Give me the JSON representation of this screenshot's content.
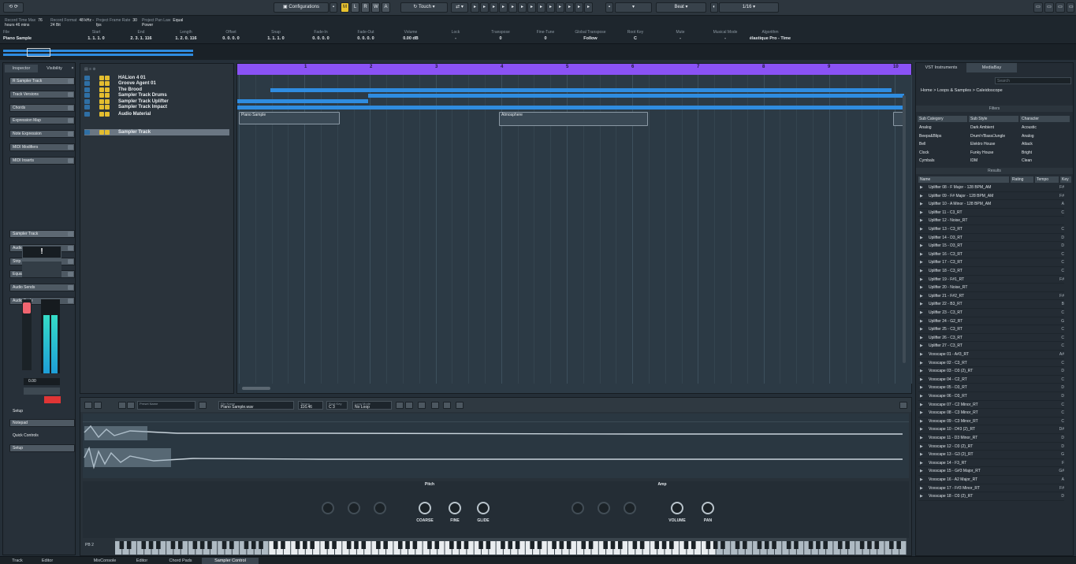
{
  "toolbar": {
    "configurations_label": "Configurations",
    "mode_buttons": [
      "M",
      "L",
      "R",
      "W",
      "A"
    ],
    "touch_label": "Touch",
    "grid_label": "Beat",
    "quantize_label": "1/16",
    "constrain_label": "",
    "transport_values": [
      {
        "label": "Record Time Max",
        "value": "76 hours 46 mins"
      },
      {
        "label": "Record Format",
        "value": "48 kHz - 24 Bit"
      },
      {
        "label": "Project Frame Rate",
        "value": "30 fps"
      },
      {
        "label": "Project Pan Law",
        "value": "Equal Power"
      }
    ]
  },
  "infoline": {
    "file_label": "File",
    "file_value": "Piano Sample",
    "columns": [
      {
        "h": "Start",
        "v": "1. 1. 1. 0"
      },
      {
        "h": "End",
        "v": "2. 3. 1. 116"
      },
      {
        "h": "Length",
        "v": "1. 2. 0. 116"
      },
      {
        "h": "Offset",
        "v": "0. 0. 0. 0"
      },
      {
        "h": "Snap",
        "v": "1. 1. 1. 0"
      },
      {
        "h": "Fade-In",
        "v": "0. 0. 0. 0"
      },
      {
        "h": "Fade-Out",
        "v": "0. 0. 0. 0"
      },
      {
        "h": "Volume",
        "v": "0.00 dB"
      },
      {
        "h": "Lock",
        "v": "-"
      },
      {
        "h": "Transpose",
        "v": "0"
      },
      {
        "h": "Fine-Tune",
        "v": "0"
      },
      {
        "h": "Global Transpose",
        "v": "Follow"
      },
      {
        "h": "Root Key",
        "v": "C"
      },
      {
        "h": "Mute",
        "v": "-"
      },
      {
        "h": "Musical Mode",
        "v": "-"
      },
      {
        "h": "Algorithm",
        "v": "élastique Pro - Time"
      }
    ]
  },
  "inspector": {
    "tab_inspector": "Inspector",
    "tab_visibility": "Visibility",
    "track_name": "Sampler Track",
    "sections": [
      "Track Versions",
      "Chords",
      "Expression Map",
      "Note Expression",
      "MIDI Modifiers",
      "MIDI Inserts"
    ],
    "sampler_track": "Sampler Track",
    "sections2": [
      "Audio Inserts",
      "Strip",
      "Equalizers",
      "Audio Sends",
      "Audio Fade"
    ],
    "meter_value": "0.00",
    "bottom_sections": [
      "Setup",
      "Notepad",
      "Quick Controls",
      "Setup"
    ]
  },
  "tracks": [
    {
      "name": "HALion 4 01"
    },
    {
      "name": "Groove Agent 01"
    },
    {
      "name": "The Brood"
    },
    {
      "name": "Sampler Track Drums"
    },
    {
      "name": "Sampler Track Uplifter"
    },
    {
      "name": "Sampler Track Impact"
    },
    {
      "name": "Audio Material"
    },
    {
      "name": "Sampler Track"
    }
  ],
  "ruler": [
    "1",
    "2",
    "3",
    "4",
    "5",
    "6",
    "7",
    "8",
    "9",
    "10",
    "11"
  ],
  "events": {
    "piano": "Piano Sample",
    "atmosphere": "Atmosphere"
  },
  "sampler": {
    "preset_label": "Preset Name",
    "file_name_label": "File Name",
    "file_name_value": "Piano Sample.wav",
    "tempo_label": "Tempo",
    "tempo_value": "116.46",
    "root_key_label": "Root Key",
    "root_key_value": "C 3",
    "loop_mode_label": "Loop Mode",
    "loop_mode_value": "No Loop",
    "pitch_title": "Pitch",
    "amp_title": "Amp",
    "knobs": [
      "COARSE",
      "FINE",
      "GLIDE",
      "VOLUME",
      "PAN"
    ],
    "pb_label": "PB",
    "pb_value": "2"
  },
  "rightzone": {
    "tab_vst": "VST Instruments",
    "tab_mediabay": "MediaBay",
    "search_placeholder": "Search",
    "breadcrumb": "Home  >  Loops & Samples  >  Caleidoscope",
    "filters_title": "Filters",
    "filter_cols": [
      "Sub Category",
      "Sub Style",
      "Character"
    ],
    "filter_rows": [
      [
        "Analog",
        "Dark Ambient",
        "Acoustic"
      ],
      [
        "Beeps&Blips",
        "Drum'n'Bass/Jungle",
        "Analog"
      ],
      [
        "Bell",
        "Elektro House",
        "Attack"
      ],
      [
        "Clock",
        "Funky House",
        "Bright"
      ],
      [
        "Cymbals",
        "IDM",
        "Clean"
      ]
    ],
    "results_title": "Results",
    "result_cols": [
      "Name",
      "Rating",
      "Tempo",
      "Key"
    ],
    "results": [
      {
        "name": "Uplifter 08 - F Major - 128 BPM_AM",
        "key": "F#"
      },
      {
        "name": "Uplifter 09 - F# Major - 128 BPM_AM",
        "key": "F#"
      },
      {
        "name": "Uplifter 10 - A Minor - 128 BPM_AM",
        "key": "A"
      },
      {
        "name": "Uplifter 11 - C3_RT",
        "key": "C"
      },
      {
        "name": "Uplifter 12 - Noise_RT",
        "key": ""
      },
      {
        "name": "Uplifter 13 - C3_RT",
        "key": "C"
      },
      {
        "name": "Uplifter 14 - D3_RT",
        "key": "D"
      },
      {
        "name": "Uplifter 15 - D3_RT",
        "key": "D"
      },
      {
        "name": "Uplifter 16 - C3_RT",
        "key": "C"
      },
      {
        "name": "Uplifter 17 - C3_RT",
        "key": "C"
      },
      {
        "name": "Uplifter 18 - C3_RT",
        "key": "C"
      },
      {
        "name": "Uplifter 19 - F#1_RT",
        "key": "F#"
      },
      {
        "name": "Uplifter 20 - Noise_RT",
        "key": ""
      },
      {
        "name": "Uplifter 21 - F#2_RT",
        "key": "F#"
      },
      {
        "name": "Uplifter 22 - B3_RT",
        "key": "B"
      },
      {
        "name": "Uplifter 23 - C3_RT",
        "key": "C"
      },
      {
        "name": "Uplifter 24 - G2_RT",
        "key": "G"
      },
      {
        "name": "Uplifter 25 - C3_RT",
        "key": "C"
      },
      {
        "name": "Uplifter 26 - C3_RT",
        "key": "C"
      },
      {
        "name": "Uplifter 27 - C3_RT",
        "key": "C"
      },
      {
        "name": "Voxscape 01 - A#3_RT",
        "key": "A#"
      },
      {
        "name": "Voxscape 02 - C3_RT",
        "key": "C"
      },
      {
        "name": "Voxscape 03 - D3 (2)_RT",
        "key": "D"
      },
      {
        "name": "Voxscape 04 - C2_RT",
        "key": "C"
      },
      {
        "name": "Voxscape 05 - D3_RT",
        "key": "D"
      },
      {
        "name": "Voxscape 06 - D3_RT",
        "key": "D"
      },
      {
        "name": "Voxscape 07 - C2 Minor_RT",
        "key": "C"
      },
      {
        "name": "Voxscape 08 - C3 Minor_RT",
        "key": "C"
      },
      {
        "name": "Voxscape 09 - C3 Minor_RT",
        "key": "C"
      },
      {
        "name": "Voxscape 10 - D#3 (2)_RT",
        "key": "D#"
      },
      {
        "name": "Voxscape 11 - D3 Minor_RT",
        "key": "D"
      },
      {
        "name": "Voxscape 12 - D3 (2)_RT",
        "key": "D"
      },
      {
        "name": "Voxscape 13 - G3 (2)_RT",
        "key": "G"
      },
      {
        "name": "Voxscape 14 - F3_RT",
        "key": "F"
      },
      {
        "name": "Voxscape 15 - G#3 Major_RT",
        "key": "G#"
      },
      {
        "name": "Voxscape 16 - A2 Major_RT",
        "key": "A"
      },
      {
        "name": "Voxscape 17 - F#3 Minor_RT",
        "key": "F#"
      },
      {
        "name": "Voxscape 18 - D3 (2)_RT",
        "key": "D"
      }
    ]
  },
  "statusbar": {
    "tabs": [
      "Track",
      "Editor",
      "MixConsole",
      "Editor",
      "Chord Pads",
      "Sampler Control"
    ]
  },
  "colors": {
    "ruler": "#8a52f5",
    "lane": "#2f8ce0",
    "track_button": "#e3bd2f",
    "meter": "#2fc6c4"
  }
}
